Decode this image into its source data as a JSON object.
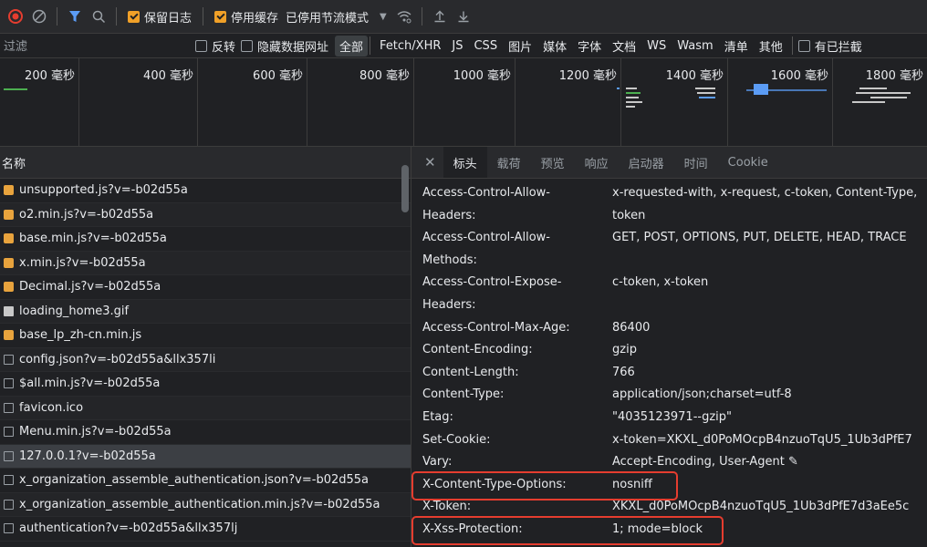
{
  "toolbar": {
    "preserve_log": "保留日志",
    "disable_cache": "停用缓存",
    "throttling": "已停用节流模式"
  },
  "filter": {
    "placeholder": "过滤",
    "invert": "反转",
    "hide_data_urls": "隐藏数据网址",
    "types": [
      "全部",
      "Fetch/XHR",
      "JS",
      "CSS",
      "图片",
      "媒体",
      "字体",
      "文档",
      "WS",
      "Wasm",
      "清单",
      "其他"
    ],
    "blocked": "有已拦截"
  },
  "timeline": {
    "ticks": [
      "200 毫秒",
      "400 毫秒",
      "600 毫秒",
      "800 毫秒",
      "1000 毫秒",
      "1200 毫秒",
      "1400 毫秒",
      "1600 毫秒",
      "1800 毫秒"
    ]
  },
  "requests": {
    "header": "名称",
    "items": [
      {
        "name": "unsupported.js?v=-b02d55a",
        "type": "script"
      },
      {
        "name": "o2.min.js?v=-b02d55a",
        "type": "script"
      },
      {
        "name": "base.min.js?v=-b02d55a",
        "type": "script"
      },
      {
        "name": "x.min.js?v=-b02d55a",
        "type": "script"
      },
      {
        "name": "Decimal.js?v=-b02d55a",
        "type": "script"
      },
      {
        "name": "loading_home3.gif",
        "type": "image"
      },
      {
        "name": "base_lp_zh-cn.min.js",
        "type": "script"
      },
      {
        "name": "config.json?v=-b02d55a&llx357li",
        "type": "doc"
      },
      {
        "name": "$all.min.js?v=-b02d55a",
        "type": "doc"
      },
      {
        "name": "favicon.ico",
        "type": "doc"
      },
      {
        "name": "Menu.min.js?v=-b02d55a",
        "type": "doc"
      },
      {
        "name": "127.0.0.1?v=-b02d55a",
        "type": "doc",
        "selected": true
      },
      {
        "name": "x_organization_assemble_authentication.json?v=-b02d55a",
        "type": "doc"
      },
      {
        "name": "x_organization_assemble_authentication.min.js?v=-b02d55a",
        "type": "doc"
      },
      {
        "name": "authentication?v=-b02d55a&llx357lj",
        "type": "doc"
      }
    ]
  },
  "detail": {
    "tabs": [
      "标头",
      "载荷",
      "预览",
      "响应",
      "启动器",
      "时间",
      "Cookie"
    ],
    "active_tab": "标头",
    "headers": [
      {
        "name": "Access-Control-Allow-",
        "value": "x-requested-with, x-request, c-token, Content-Type,"
      },
      {
        "name": "Headers:",
        "value": "token"
      },
      {
        "name": "Access-Control-Allow-",
        "value": "GET, POST, OPTIONS, PUT, DELETE, HEAD, TRACE"
      },
      {
        "name": "Methods:",
        "value": ""
      },
      {
        "name": "Access-Control-Expose-",
        "value": "c-token, x-token"
      },
      {
        "name": "Headers:",
        "value": ""
      },
      {
        "name": "Access-Control-Max-Age:",
        "value": "86400"
      },
      {
        "name": "Content-Encoding:",
        "value": "gzip"
      },
      {
        "name": "Content-Length:",
        "value": "766"
      },
      {
        "name": "Content-Type:",
        "value": "application/json;charset=utf-8"
      },
      {
        "name": "Etag:",
        "value": "\"4035123971--gzip\""
      },
      {
        "name": "Set-Cookie:",
        "value": "x-token=XKXL_d0PoMOcpB4nzuoTqU5_1Ub3dPfE7"
      },
      {
        "name": "Vary:",
        "value": "Accept-Encoding, User-Agent ✎"
      },
      {
        "name": "X-Content-Type-Options:",
        "value": "nosniff",
        "highlight": true
      },
      {
        "name": "X-Token:",
        "value": "XKXL_d0PoMOcpB4nzuoTqU5_1Ub3dPfE7d3aEe5c"
      },
      {
        "name": "X-Xss-Protection:",
        "value": "1; mode=block",
        "highlight": true
      }
    ]
  },
  "colors": {
    "accent_checkbox": "#f0a028",
    "record": "#e53d2f",
    "filter_icon": "#5b9cf5",
    "highlight_box": "#e53d2f"
  }
}
